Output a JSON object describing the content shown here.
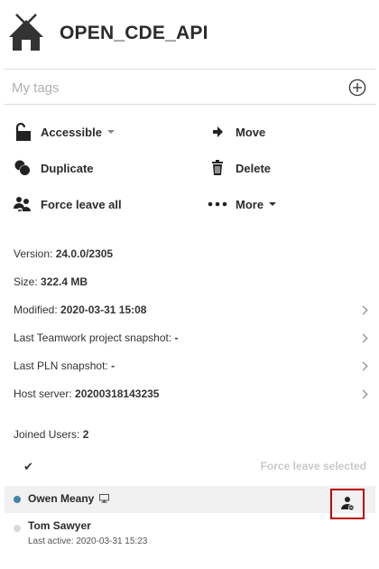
{
  "header": {
    "title": "OPEN_CDE_API",
    "icon": "house-icon"
  },
  "tags": {
    "placeholder": "My tags",
    "add_icon": "plus-circle-icon"
  },
  "actions": {
    "accessible": "Accessible",
    "move": "Move",
    "duplicate": "Duplicate",
    "delete": "Delete",
    "force_leave_all": "Force leave all",
    "more": "More"
  },
  "info": {
    "version_label": "Version:",
    "version_value": "24.0.0/2305",
    "size_label": "Size:",
    "size_value": "322.4 MB",
    "modified_label": "Modified:",
    "modified_value": "2020-03-31 15:08",
    "teamwork_label": "Last Teamwork project snapshot:",
    "teamwork_value": "-",
    "pln_label": "Last PLN snapshot:",
    "pln_value": "-",
    "host_label": "Host server:",
    "host_value": "20200318143235"
  },
  "joined": {
    "label": "Joined Users:",
    "count": "2"
  },
  "selection": {
    "check": "✔",
    "force_leave_selected": "Force leave selected"
  },
  "users": [
    {
      "name": "Owen Meany",
      "status_color": "#3f86a8"
    },
    {
      "name": "Tom Sawyer",
      "sub": "Last active: 2020-03-31 15:23",
      "status_color": "#d9d9d9"
    }
  ],
  "colors": {
    "highlight": "#c00000"
  }
}
